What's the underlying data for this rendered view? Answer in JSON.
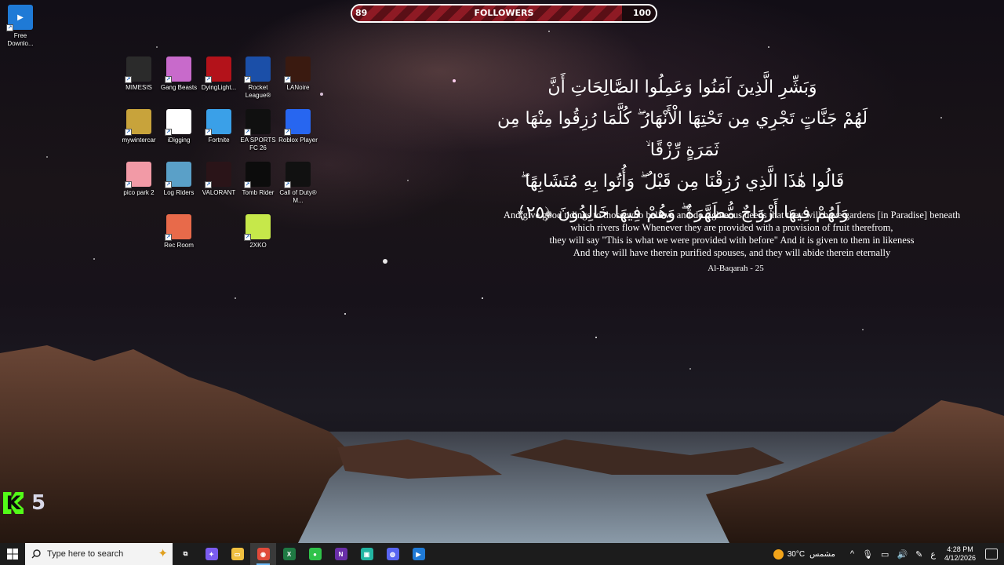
{
  "followers_bar": {
    "current": "89",
    "label": "FOLLOWERS",
    "goal": "100",
    "progress_fraction": 0.89
  },
  "desktop": {
    "corner_icon": {
      "label": "Free Downlo...",
      "color": "#1f7ad6"
    },
    "icons": [
      {
        "label": "MIMESIS",
        "color": "#2b2b2b",
        "icon": "mimesis-icon"
      },
      {
        "label": "Gang Beasts",
        "color": "#c86acb",
        "icon": "gang-beasts-icon"
      },
      {
        "label": "DyingLight...",
        "color": "#b3121a",
        "icon": "dying-light-icon"
      },
      {
        "label": "Rocket League®",
        "color": "#1b4fa8",
        "icon": "rocket-league-icon"
      },
      {
        "label": "LANoire",
        "color": "#3a1a10",
        "icon": "la-noire-icon"
      },
      {
        "label": "mywintercar",
        "color": "#c8a33b",
        "icon": "my-winter-car-icon"
      },
      {
        "label": "iDigging",
        "color": "#ffffff",
        "icon": "file-icon"
      },
      {
        "label": "Fortnite",
        "color": "#3aa0e8",
        "icon": "fortnite-icon"
      },
      {
        "label": "EA SPORTS FC 26",
        "color": "#101010",
        "icon": "fc26-icon"
      },
      {
        "label": "Roblox Player",
        "color": "#2766f0",
        "icon": "roblox-icon"
      },
      {
        "label": "pico park 2",
        "color": "#f29aa6",
        "icon": "pico-park-icon"
      },
      {
        "label": "Log Riders",
        "color": "#5aa0c8",
        "icon": "log-riders-icon"
      },
      {
        "label": "VALORANT",
        "color": "#2a1418",
        "icon": "valorant-icon"
      },
      {
        "label": "Tomb Rider",
        "color": "#0c0c0c",
        "icon": "tomb-raider-icon"
      },
      {
        "label": "Call of Duty® M...",
        "color": "#111111",
        "icon": "call-of-duty-icon"
      },
      {
        "label": "Rec Room",
        "color": "#e86a4a",
        "icon": "rec-room-icon"
      },
      {
        "label": "2XKO",
        "color": "#c6e84a",
        "icon": "2xko-icon"
      }
    ]
  },
  "verse": {
    "arabic_lines": [
      "وَبَشِّرِ الَّذِينَ آمَنُوا وَعَمِلُوا الصَّالِحَاتِ أَنَّ",
      "لَهُمْ جَنَّاتٍ تَجْرِي مِن تَحْتِهَا الْأَنْهَارُ ۖ كُلَّمَا رُزِقُوا مِنْهَا مِن ثَمَرَةٍ رِّزْقًا ۙ",
      "قَالُوا هَٰذَا الَّذِي رُزِقْنَا مِن قَبْلُ ۖ وَأُتُوا بِهِ مُتَشَابِهًا ۖ",
      "وَلَهُمْ فِيهَا أَزْوَاجٌ مُّطَهَّرَةٌ ۖ وَهُمْ فِيهَا خَالِدُونَ ﴿٢٥﴾"
    ],
    "english_lines": [
      "And give good tidings to those who believe and do righteous deeds that they will have gardens [in Paradise] beneath",
      "which rivers flow Whenever they are provided with a provision of fruit therefrom,",
      "they will say \"This is what we were provided with before\" And it is given to them in likeness",
      "And they will have therein purified spouses, and they will abide therein eternally"
    ],
    "reference": "Al-Baqarah - 25"
  },
  "kick_widget": {
    "letter": "K",
    "count": "5"
  },
  "taskbar": {
    "search_placeholder": "Type here to search",
    "apps": [
      {
        "name": "task-view-icon",
        "color": "#1c1c1c",
        "glyph": "⧉"
      },
      {
        "name": "copilot-icon",
        "color": "#7b5cf0",
        "glyph": "✦"
      },
      {
        "name": "file-explorer-icon",
        "color": "#f0c040",
        "glyph": "▭"
      },
      {
        "name": "chrome-icon",
        "color": "#e04a3a",
        "glyph": "◉",
        "active": true
      },
      {
        "name": "excel-icon",
        "color": "#1f7a43",
        "glyph": "X"
      },
      {
        "name": "xbox-app-icon",
        "color": "#2fc24a",
        "glyph": "●"
      },
      {
        "name": "next-app-icon",
        "color": "#6a2fa8",
        "glyph": "N"
      },
      {
        "name": "chat-app-icon",
        "color": "#23b5a2",
        "glyph": "▣"
      },
      {
        "name": "discord-icon",
        "color": "#5865f2",
        "glyph": "◍"
      },
      {
        "name": "downloader-app-icon",
        "color": "#1f7ad6",
        "glyph": "▶"
      }
    ],
    "weather": {
      "temp": "30°C",
      "condition": "مشمس"
    },
    "lang": "ع",
    "time": "4:28 PM",
    "date": "4/12/2026"
  }
}
